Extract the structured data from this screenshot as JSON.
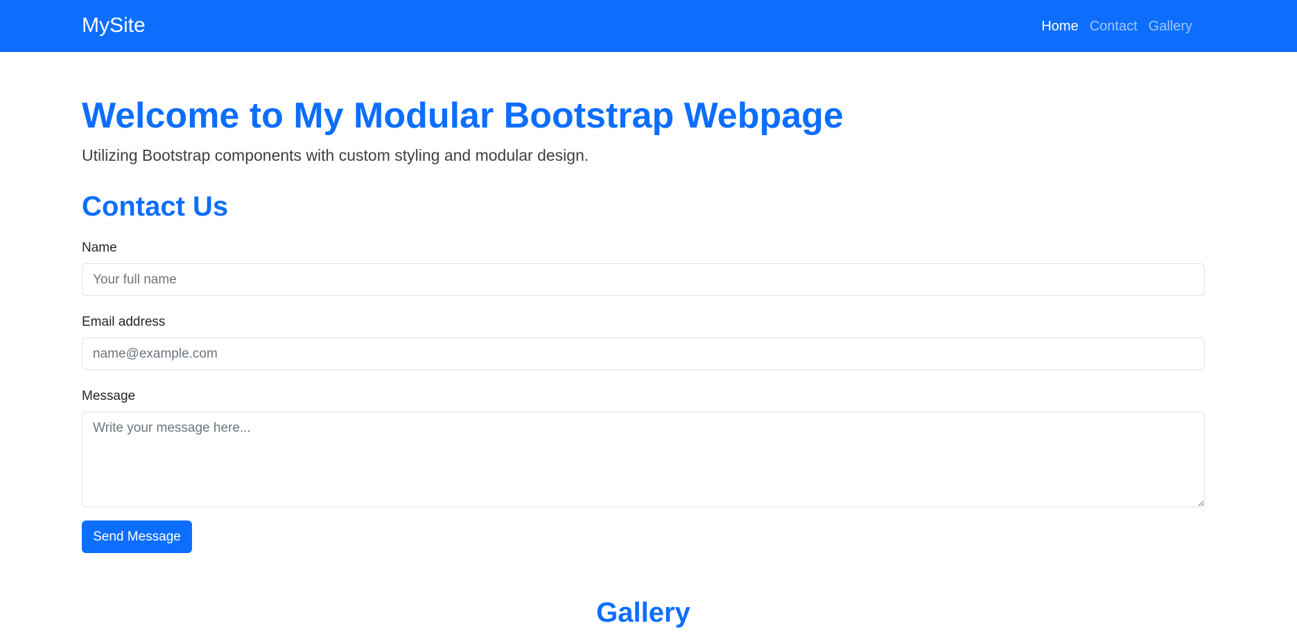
{
  "navbar": {
    "brand": "MySite",
    "links": [
      {
        "label": "Home",
        "active": true
      },
      {
        "label": "Contact",
        "active": false
      },
      {
        "label": "Gallery",
        "active": false
      }
    ],
    "bg_color": "#0d6efd"
  },
  "hero": {
    "title": "Welcome to My Modular Bootstrap Webpage",
    "subtitle": "Utilizing Bootstrap components with custom styling and modular design."
  },
  "contact": {
    "title": "Contact Us",
    "name_label": "Name",
    "name_placeholder": "Your full name",
    "name_value": "",
    "email_label": "Email address",
    "email_placeholder": "name@example.com",
    "email_value": "",
    "message_label": "Message",
    "message_placeholder": "Write your message here...",
    "message_value": "",
    "submit_label": "Send Message"
  },
  "gallery": {
    "title": "Gallery"
  },
  "colors": {
    "primary": "#0d6efd",
    "text": "#212529",
    "border": "#dee2e6"
  }
}
